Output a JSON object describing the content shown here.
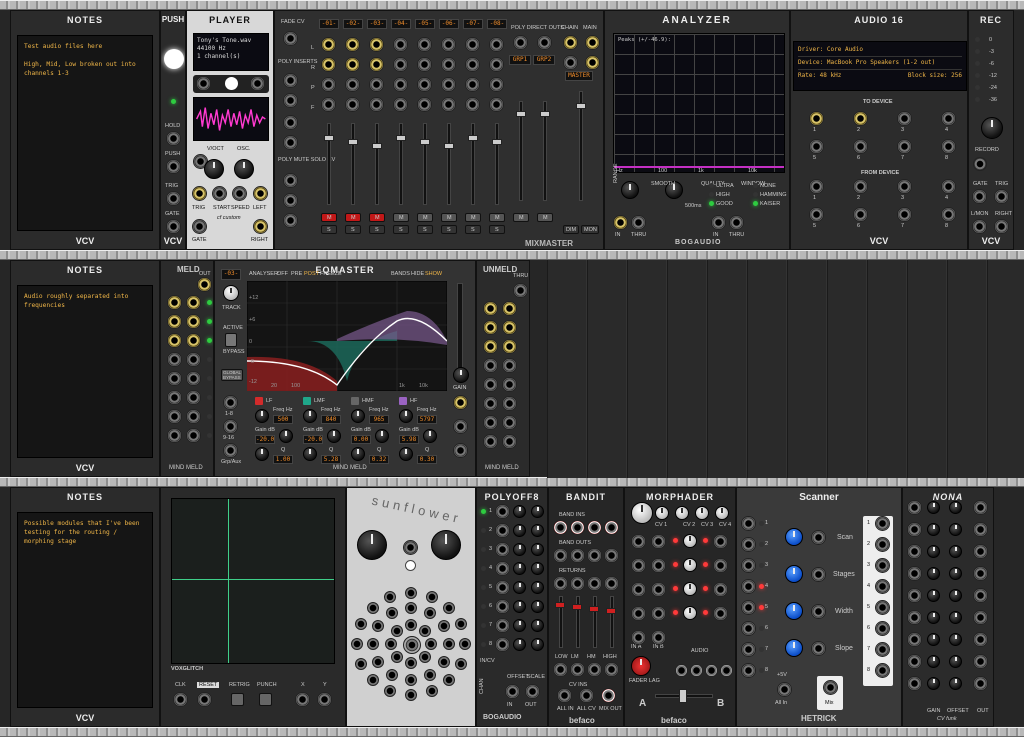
{
  "notes": [
    {
      "title": "NOTES",
      "text": "Test audio files here\n\nHigh, Mid, Low broken out into channels 1-3",
      "footer": "VCV"
    },
    {
      "title": "NOTES",
      "text": "Audio roughly separated into frequencies",
      "footer": "VCV"
    },
    {
      "title": "NOTES",
      "text": "Possible modules that I've been testing for the routing / morphing stage",
      "footer": "VCV"
    }
  ],
  "push": {
    "title": "PUSH",
    "labels": [
      "HOLD",
      "PUSH",
      "TRIG",
      "GATE"
    ],
    "footer": "VCV"
  },
  "player": {
    "title": "PLAYER",
    "file": "Tony's Tone.wav",
    "rate": "44100 Hz",
    "channels": "1 channel(s)",
    "labels": [
      "V/OCT",
      "OSC.",
      "TRIG",
      "START",
      "SPEED",
      "LEFT",
      "GATE",
      "RIGHT"
    ],
    "brand": "cf custom"
  },
  "mixmaster": {
    "sections": [
      "FADE CV",
      "POLY INSERTS",
      "POLY MUTE SOLO CV",
      "POLY DIRECT OUTS",
      "CHAIN",
      "MAIN"
    ],
    "channels": [
      "-01-",
      "-02-",
      "-03-",
      "-04-",
      "-05-",
      "-06-",
      "-07-",
      "-08-"
    ],
    "grp": [
      "GRP1",
      "GRP2"
    ],
    "master": "MASTER",
    "buttons": [
      "M",
      "S",
      "DIM",
      "MON"
    ],
    "rowlabels": [
      "L",
      "R",
      "P",
      "F"
    ],
    "subs": [
      "1-8",
      "Grp/Aux",
      "1-8",
      "Grp/Aux",
      "M 1-8",
      "S 1-8",
      "Grp/Aux"
    ],
    "brand": "MIXMASTER"
  },
  "analyzer": {
    "title": "ANALYZER",
    "peaks": "Peaks (+/-46.9):",
    "ticks": [
      "Hz",
      "100",
      "1k",
      "10k"
    ],
    "range": "RANGE",
    "smooth": "SMOOTH",
    "quality": "QUALITY",
    "window": "WINDOW",
    "qualities": [
      "ULTRA",
      "HIGH",
      "GOOD"
    ],
    "windows": [
      "NONE",
      "HAMMING",
      "KAISER"
    ],
    "ms": "500ms",
    "io": [
      "IN",
      "THRU",
      "IN",
      "THRU"
    ],
    "brand": "BOGAUDIO"
  },
  "audio16": {
    "title": "AUDIO 16",
    "driver": "Driver: Core Audio",
    "device": "Device: MacBook Pro Speakers (1-2 out)",
    "rate": "Rate: 48 kHz",
    "block": "Block size: 256",
    "to_device": "TO DEVICE",
    "from_device": "FROM DEVICE",
    "footer": "VCV"
  },
  "rec": {
    "title": "REC",
    "scale": [
      "0",
      "-3",
      "-6",
      "-12",
      "-24",
      "-36"
    ],
    "labels": [
      "RECORD",
      "GATE",
      "TRIG",
      "L/MON",
      "RIGHT"
    ],
    "footer": "VCV"
  },
  "meld": {
    "title": "MELD",
    "out": "OUT",
    "in": "IN",
    "brand": "MIND MELD"
  },
  "eqmaster": {
    "title": "EQMASTER",
    "track": "-03-",
    "analyser": "ANALYSER:",
    "modes": [
      "OFF",
      "PRE",
      "POST",
      "FREEZE"
    ],
    "bands_label": "BANDS",
    "bands_modes": [
      "HIDE",
      "SHOW"
    ],
    "dbticks": [
      "+12",
      "+6",
      "0",
      "-6",
      "-12"
    ],
    "fticks": [
      "20",
      "100",
      "1k",
      "10k"
    ],
    "labels": [
      "TRACK",
      "ACTIVE",
      "BYPASS",
      "GLOBAL BYPASS",
      "GAIN",
      "1-8",
      "9-16",
      "Grp/Aux"
    ],
    "bands": [
      {
        "name": "LF",
        "freq": "500",
        "gain": "-20.0",
        "q": "1.00"
      },
      {
        "name": "LMF",
        "freq": "840",
        "gain": "-20.0",
        "q": "5.28"
      },
      {
        "name": "HMF",
        "freq": "965",
        "gain": "0.00",
        "q": "0.32"
      },
      {
        "name": "HF",
        "freq": "5797",
        "gain": "5.98",
        "q": "0.30"
      }
    ],
    "field_labels": [
      "Freq Hz",
      "Gain dB",
      "Q"
    ]
  },
  "unmeld": {
    "title": "UNMELD",
    "thru": "THRU"
  },
  "vox": {
    "title": "VOXGLITCH",
    "labels": [
      "CLK",
      "RESET",
      "RETRIG",
      "PUNCH",
      "X",
      "Y"
    ]
  },
  "sunflower": {
    "title": "sunflower"
  },
  "polyoff8": {
    "title": "POLYOFF8",
    "chan": "CHAN",
    "labels": [
      "IN/CV",
      "OFFSET",
      "SCALE",
      "IN",
      "OUT"
    ],
    "brand": "BOGAUDIO"
  },
  "bandit": {
    "title": "BANDIT",
    "labels": [
      "BAND INS",
      "BAND OUTS",
      "RETURNS",
      "LOW",
      "LM",
      "HM",
      "HIGH",
      "CV INS",
      "ALL IN",
      "ALL CV",
      "MIX OUT"
    ],
    "brand": "befaco"
  },
  "morphader": {
    "title": "MORPHADER",
    "labels": [
      "CV 1",
      "CV 2",
      "CV 3",
      "CV 4",
      "IN A",
      "IN B",
      "FADER LAG",
      "A",
      "B",
      "AUDIO"
    ],
    "brand": "befaco"
  },
  "scanner": {
    "title": "Scanner",
    "knobs": [
      "Scan",
      "Stages",
      "Width",
      "Slope"
    ],
    "labels": [
      "+5V",
      "All In",
      "Mix"
    ],
    "brand": "HETRICK"
  },
  "nona": {
    "title": "NONA",
    "labels": [
      "GAIN",
      "OFFSET",
      "OUT",
      "CV funk"
    ]
  }
}
